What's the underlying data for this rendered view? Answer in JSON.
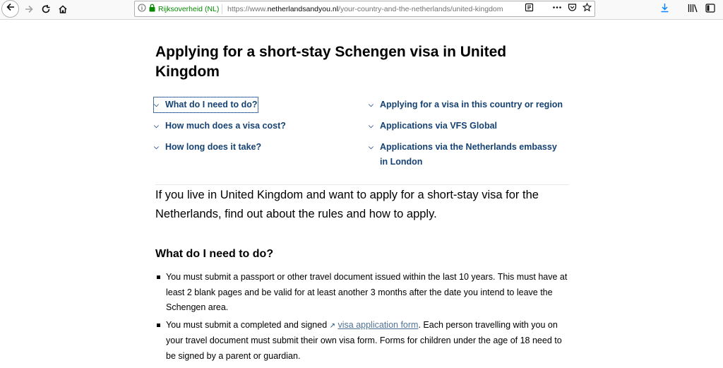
{
  "browser": {
    "identity": "Rijksoverheid (NL)",
    "url_prefix": "https://www.",
    "url_host": "netherlandsandyou.nl",
    "url_path": "/your-country-and-the-netherlands/united-kingdom"
  },
  "page": {
    "title": "Applying for a short-stay Schengen visa in United Kingdom",
    "toc": [
      {
        "label": "What do I need to do?"
      },
      {
        "label": "How much does a visa cost?"
      },
      {
        "label": "How long does it take?"
      },
      {
        "label": "Applying for a visa in this country or region"
      },
      {
        "label": "Applications via VFS Global"
      },
      {
        "label": "Applications via the Netherlands embassy in London"
      }
    ],
    "intro": "If you live in United Kingdom and want to apply for a short-stay visa for the Netherlands, find out about the rules and how to apply.",
    "section_heading": "What do I need to do?",
    "bullet1": "You must submit a passport or other travel document issued within the last 10 years. This must have at least 2 blank pages and be valid for at least another 3 months after the date you intend to leave the Schengen area.",
    "bullet2_before": "You must submit a completed and signed ",
    "bullet2_link": "visa application form",
    "bullet2_after": ". Each person travelling with you on your travel document must submit their own visa form. Forms for children under the age of 18 need to be signed by a parent or guardian."
  },
  "colors": {
    "link": "#154273",
    "secure": "#058b00"
  }
}
